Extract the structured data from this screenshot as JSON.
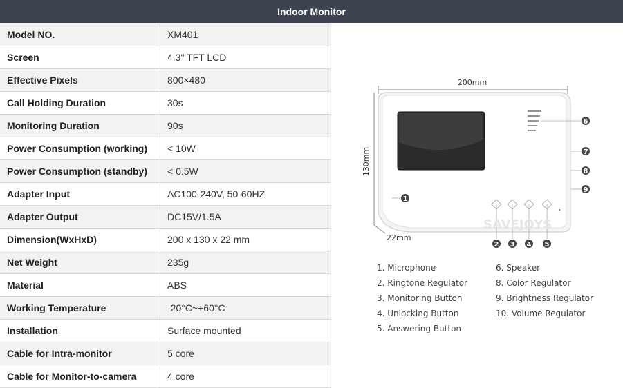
{
  "header": {
    "title": "Indoor Monitor"
  },
  "specs": [
    {
      "label": "Model NO.",
      "value": "XM401"
    },
    {
      "label": "Screen",
      "value": "4.3\" TFT LCD"
    },
    {
      "label": "Effective Pixels",
      "value": "800×480"
    },
    {
      "label": "Call Holding Duration",
      "value": "30s"
    },
    {
      "label": "Monitoring Duration",
      "value": "90s"
    },
    {
      "label": "Power Consumption (working)",
      "value": "< 10W"
    },
    {
      "label": "Power Consumption (standby)",
      "value": "< 0.5W"
    },
    {
      "label": "Adapter Input",
      "value": "AC100-240V, 50-60HZ"
    },
    {
      "label": "Adapter Output",
      "value": "DC15V/1.5A"
    },
    {
      "label": "Dimension(WxHxD)",
      "value": "200 x 130 x 22 mm"
    },
    {
      "label": "Net Weight",
      "value": "235g"
    },
    {
      "label": "Material",
      "value": "ABS"
    },
    {
      "label": "Working Temperature",
      "value": "-20°C~+60°C"
    },
    {
      "label": "Installation",
      "value": "Surface mounted"
    },
    {
      "label": "Cable for Intra-monitor",
      "value": "5 core"
    },
    {
      "label": "Cable for Monitor-to-camera",
      "value": "4 core"
    }
  ],
  "diagram": {
    "width_label": "200mm",
    "height_label": "130mm",
    "depth_label": "22mm",
    "watermark": "SAVEJOYS",
    "badges": [
      "1",
      "2",
      "3",
      "4",
      "5",
      "6",
      "7",
      "8",
      "9"
    ],
    "legend_left": [
      "1. Microphone",
      "2. Ringtone Regulator",
      "3. Monitoring Button",
      "4. Unlocking Button",
      "5. Answering Button"
    ],
    "legend_right": [
      "6. Speaker",
      "8. Color Regulator",
      "9. Brightness Regulator",
      "10. Volume Regulator"
    ]
  }
}
